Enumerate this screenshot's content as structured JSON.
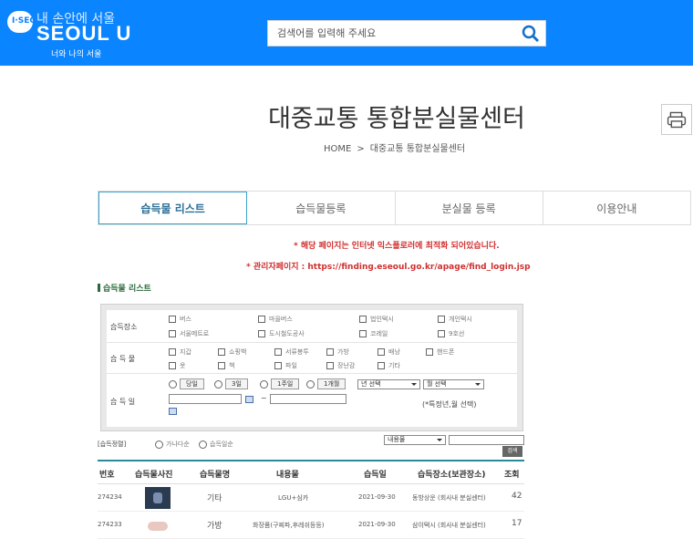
{
  "header": {
    "logo_over": "내 손안에 서울",
    "logo_main": "SEOUL U",
    "logo_sub": "너와 나의 서울",
    "logo_badge": "I·SEOUL",
    "search_placeholder": "검색어를 입력해 주세요",
    "brand_color": "#0a84ff"
  },
  "page": {
    "title": "대중교통 통합분실물센터",
    "breadcrumb": [
      "HOME",
      "대중교통 통합분실물센터"
    ],
    "breadcrumb_sep": ">"
  },
  "tabs": [
    {
      "label": "습득물 리스트",
      "active": true
    },
    {
      "label": "습득물등록",
      "active": false
    },
    {
      "label": "분실물 등록",
      "active": false
    },
    {
      "label": "이용안내",
      "active": false
    }
  ],
  "notices": {
    "line1": "* 해당 페이지는 인터넷 익스플로러에 최적화 되어있습니다.",
    "line2": "* 관리자페이지 : https://finding.eseoul.go.kr/apage/find_login.jsp"
  },
  "section_title": "습득물 리스트",
  "filter": {
    "place_label": "습득장소",
    "places": [
      "버스",
      "마을버스",
      "법인택시",
      "개인택시",
      "서울메트로",
      "도시철도공사",
      "코레일",
      "9호선"
    ],
    "item_label": "습 득 물",
    "items": [
      "지갑",
      "쇼핑백",
      "서류봉투",
      "가방",
      "배낭",
      "핸드폰",
      "옷",
      "책",
      "파일",
      "장난감",
      "기타"
    ],
    "date_label": "습 득 일",
    "periods": [
      "당일",
      "3일",
      "1주일",
      "1개월"
    ],
    "date_sep": "~",
    "year_select": "년 선택",
    "month_select": "월 선택",
    "hint": "(*특정년,월 선택)"
  },
  "sort": {
    "label": "[습득정렬]",
    "options": [
      "가나다순",
      "습득일순"
    ],
    "select_value": "내용물",
    "button": "검색"
  },
  "table": {
    "headers": [
      "번호",
      "습득물사진",
      "습득물명",
      "내용물",
      "습득일",
      "습득장소(보관장소)",
      "조회"
    ],
    "rows": [
      {
        "no": "274234",
        "name": "기타",
        "content": "LGU+심카",
        "date": "2021-09-30",
        "place": "동방상운 (회사내 분실센터)",
        "views": "42"
      },
      {
        "no": "274233",
        "name": "가방",
        "content": "화장품(구찌파,후레쉬등등)",
        "date": "2021-09-30",
        "place": "삼이택시 (회사내 분실센터)",
        "views": "17"
      }
    ]
  }
}
